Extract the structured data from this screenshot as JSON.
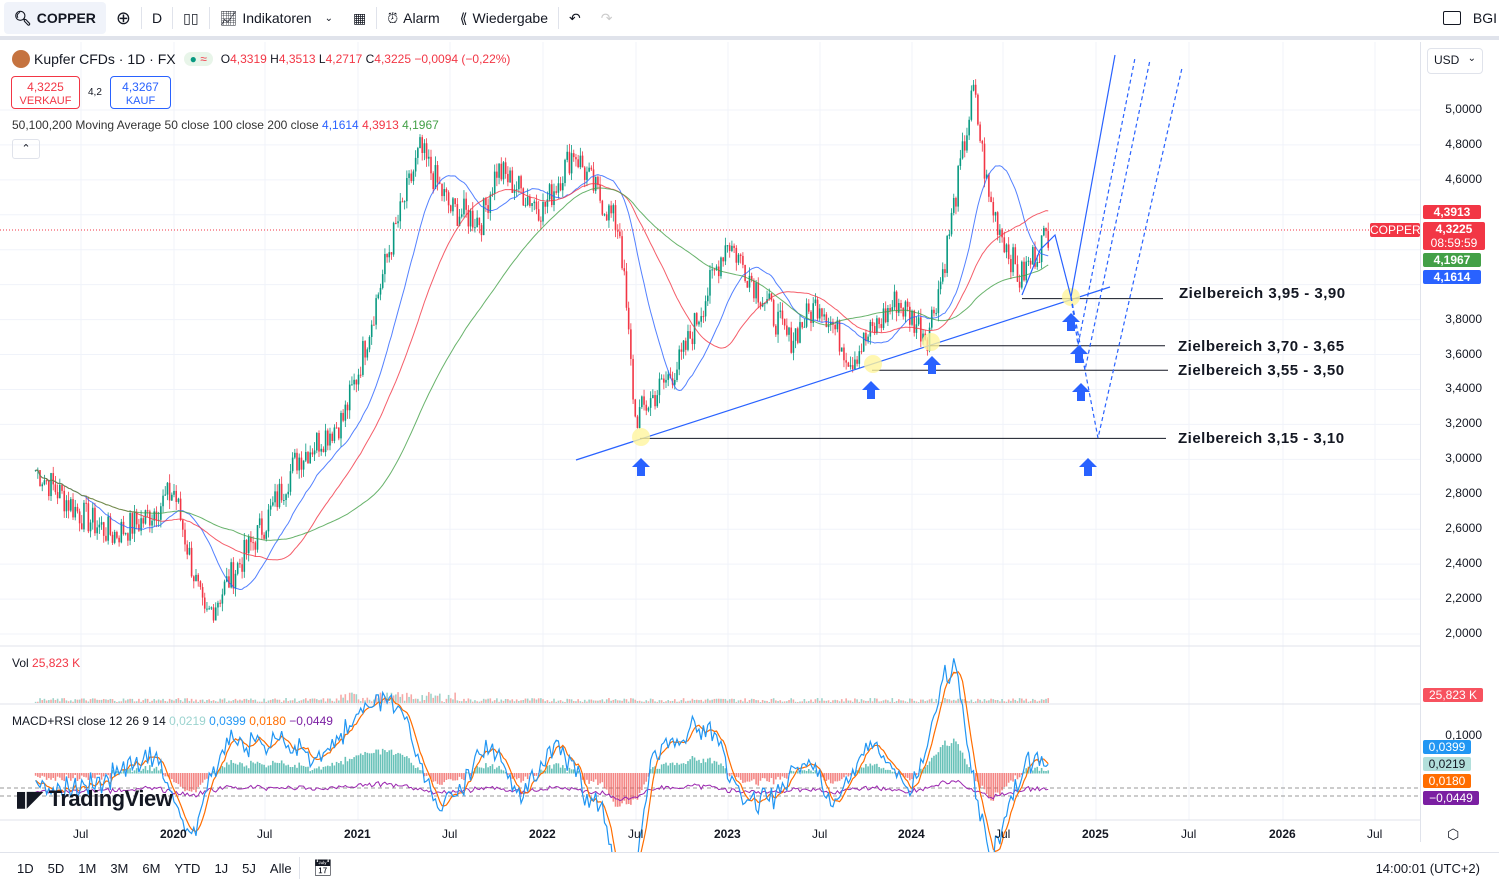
{
  "toolbar": {
    "symbol": "COPPER",
    "interval": "D",
    "indicators": "Indikatoren",
    "alarm": "Alarm",
    "replay": "Wiedergabe",
    "account": "BGI"
  },
  "legend": {
    "title": "Kupfer CFDs · 1D · FX",
    "o_label": "O",
    "o": "4,3319",
    "h_label": "H",
    "h": "4,3513",
    "l_label": "L",
    "l": "4,2717",
    "c_label": "C",
    "c": "4,3225",
    "change": "−0,0094 (−0,22%)",
    "sell_price": "4,3225",
    "sell_label": "VERKAUF",
    "spread": "4,2",
    "buy_price": "4,3267",
    "buy_label": "KAUF",
    "ma_title": "50,100,200 Moving Average 50 close 100 close 200 close",
    "ma50": "4,1614",
    "ma100": "4,3913",
    "ma200": "4,1967",
    "vol_label": "Vol",
    "vol_value": "25,823 K",
    "macd_title": "MACD+RSI close 12 26 9 14",
    "macd_hist": "0,0219",
    "macd": "0,0399",
    "signal": "0,0180",
    "rsi": "−0,0449"
  },
  "price_axis": {
    "currency": "USD",
    "ticks": [
      "5,0000",
      "4,8000",
      "4,6000",
      "3,8000",
      "3,6000",
      "3,4000",
      "3,2000",
      "3,0000",
      "2,8000",
      "2,6000",
      "2,4000",
      "2,2000",
      "2,0000"
    ],
    "tags": {
      "ma100": "4,3913",
      "last": "4,3225",
      "countdown": "08:59:59",
      "ma200": "4,1967",
      "ma50": "4,1614",
      "symbol": "COPPER",
      "vol": "25,823 K",
      "macd": "0,0399",
      "hist": "0,0219",
      "signal": "0,0180",
      "rsi": "−0,0449",
      "macd_top": "0,1000"
    }
  },
  "time_axis": [
    "Jul",
    "2020",
    "Jul",
    "2021",
    "Jul",
    "2022",
    "Jul",
    "2023",
    "Jul",
    "2024",
    "Jul",
    "2025",
    "Jul",
    "2026",
    "Jul"
  ],
  "bottom": {
    "ranges": [
      "1D",
      "5D",
      "1M",
      "3M",
      "6M",
      "YTD",
      "1J",
      "5J",
      "Alle"
    ],
    "clock": "14:00:01 (UTC+2)"
  },
  "colors": {
    "up": "#089981",
    "down": "#f23645",
    "ma50": "#2962ff",
    "ma100": "#f23645",
    "ma200": "#43a047",
    "annotation": "#2962ff"
  },
  "chart_data": {
    "type": "line",
    "title": "Kupfer CFDs · 1D · FX",
    "xlabel": "",
    "ylabel": "",
    "ylim": [
      2.0,
      5.2
    ],
    "grid": true,
    "x": [
      "2019-04",
      "2019-07",
      "2019-09",
      "2019-11",
      "2020-01",
      "2020-03",
      "2020-05",
      "2020-07",
      "2020-09",
      "2020-12",
      "2021-01",
      "2021-03",
      "2021-05",
      "2021-07",
      "2021-09",
      "2021-10",
      "2022-01",
      "2022-03",
      "2022-04",
      "2022-06",
      "2022-07",
      "2022-09",
      "2022-10",
      "2023-01",
      "2023-03",
      "2023-05",
      "2023-07",
      "2023-09",
      "2023-12",
      "2024-02",
      "2024-03",
      "2024-05",
      "2024-06",
      "2024-08",
      "2024-10"
    ],
    "series": [
      {
        "values": [
          2.94,
          2.68,
          2.57,
          2.65,
          2.82,
          2.08,
          2.37,
          2.65,
          3.0,
          3.23,
          3.51,
          4.2,
          4.77,
          4.43,
          4.37,
          4.66,
          4.43,
          4.77,
          4.6,
          4.31,
          3.23,
          3.45,
          3.57,
          4.26,
          3.97,
          3.68,
          3.91,
          3.57,
          3.91,
          3.71,
          4.08,
          5.11,
          4.49,
          4.03,
          4.32
        ]
      }
    ],
    "annotations": [
      {
        "label": "Zielbereich 3,95 - 3,90",
        "level": 3.92
      },
      {
        "label": "Zielbereich 3,70 - 3,65",
        "level": 3.65
      },
      {
        "label": "Zielbereich 3,55 - 3,50",
        "level": 3.51
      },
      {
        "label": "Zielbereich 3,15 - 3,10",
        "level": 3.12
      }
    ]
  }
}
